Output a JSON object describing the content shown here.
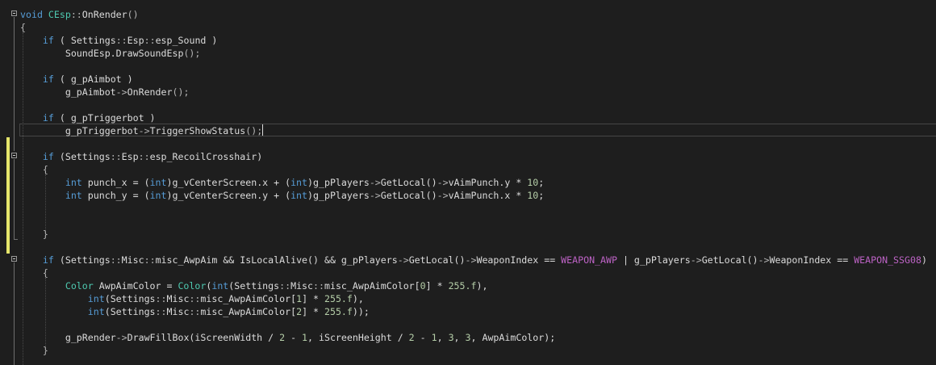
{
  "editor": {
    "caret_line": 9,
    "lines": [
      {
        "indent": "",
        "tokens": [
          {
            "c": "k",
            "t": "void"
          },
          {
            "c": "i",
            "t": " "
          },
          {
            "c": "t",
            "t": "CEsp"
          },
          {
            "c": "p",
            "t": "::"
          },
          {
            "c": "i",
            "t": "OnRender"
          },
          {
            "c": "p",
            "t": "()"
          }
        ]
      },
      {
        "indent": "",
        "tokens": [
          {
            "c": "p",
            "t": "{"
          }
        ]
      },
      {
        "indent": "    ",
        "tokens": [
          {
            "c": "k",
            "t": "if"
          },
          {
            "c": "i",
            "t": " ( "
          },
          {
            "c": "i",
            "t": "Settings"
          },
          {
            "c": "p",
            "t": "::"
          },
          {
            "c": "i",
            "t": "Esp"
          },
          {
            "c": "p",
            "t": "::"
          },
          {
            "c": "i",
            "t": "esp_Sound"
          },
          {
            "c": "i",
            "t": " )"
          }
        ]
      },
      {
        "indent": "        ",
        "tokens": [
          {
            "c": "i",
            "t": "SoundEsp.DrawSoundEsp"
          },
          {
            "c": "p",
            "t": "();"
          }
        ]
      },
      {
        "indent": "",
        "tokens": []
      },
      {
        "indent": "    ",
        "tokens": [
          {
            "c": "k",
            "t": "if"
          },
          {
            "c": "i",
            "t": " ( g_pAimbot )"
          }
        ]
      },
      {
        "indent": "        ",
        "tokens": [
          {
            "c": "i",
            "t": "g_pAimbot"
          },
          {
            "c": "p",
            "t": "->"
          },
          {
            "c": "i",
            "t": "OnRender"
          },
          {
            "c": "p",
            "t": "();"
          }
        ]
      },
      {
        "indent": "",
        "tokens": []
      },
      {
        "indent": "    ",
        "tokens": [
          {
            "c": "k",
            "t": "if"
          },
          {
            "c": "i",
            "t": " ( g_pTriggerbot )"
          }
        ]
      },
      {
        "indent": "        ",
        "tokens": [
          {
            "c": "i",
            "t": "g_pTriggerbot"
          },
          {
            "c": "p",
            "t": "->"
          },
          {
            "c": "i",
            "t": "TriggerShowStatus"
          },
          {
            "c": "p",
            "t": "();"
          }
        ]
      },
      {
        "indent": "",
        "tokens": []
      },
      {
        "indent": "    ",
        "tokens": [
          {
            "c": "k",
            "t": "if"
          },
          {
            "c": "i",
            "t": " (Settings"
          },
          {
            "c": "p",
            "t": "::"
          },
          {
            "c": "i",
            "t": "Esp"
          },
          {
            "c": "p",
            "t": "::"
          },
          {
            "c": "i",
            "t": "esp_RecoilCrosshair)"
          }
        ]
      },
      {
        "indent": "    ",
        "tokens": [
          {
            "c": "p",
            "t": "{"
          }
        ]
      },
      {
        "indent": "        ",
        "tokens": [
          {
            "c": "k",
            "t": "int"
          },
          {
            "c": "i",
            "t": " punch_x = ("
          },
          {
            "c": "k",
            "t": "int"
          },
          {
            "c": "i",
            "t": ")g_vCenterScreen.x + ("
          },
          {
            "c": "k",
            "t": "int"
          },
          {
            "c": "i",
            "t": ")g_pPlayers"
          },
          {
            "c": "p",
            "t": "->"
          },
          {
            "c": "i",
            "t": "GetLocal()"
          },
          {
            "c": "p",
            "t": "->"
          },
          {
            "c": "i",
            "t": "vAimPunch.y * "
          },
          {
            "c": "n",
            "t": "10"
          },
          {
            "c": "i",
            "t": ";"
          }
        ]
      },
      {
        "indent": "        ",
        "tokens": [
          {
            "c": "k",
            "t": "int"
          },
          {
            "c": "i",
            "t": " punch_y = ("
          },
          {
            "c": "k",
            "t": "int"
          },
          {
            "c": "i",
            "t": ")g_vCenterScreen.y + ("
          },
          {
            "c": "k",
            "t": "int"
          },
          {
            "c": "i",
            "t": ")g_pPlayers"
          },
          {
            "c": "p",
            "t": "->"
          },
          {
            "c": "i",
            "t": "GetLocal()"
          },
          {
            "c": "p",
            "t": "->"
          },
          {
            "c": "i",
            "t": "vAimPunch.x * "
          },
          {
            "c": "n",
            "t": "10"
          },
          {
            "c": "i",
            "t": ";"
          }
        ]
      },
      {
        "indent": "",
        "tokens": []
      },
      {
        "indent": "",
        "tokens": []
      },
      {
        "indent": "    ",
        "tokens": [
          {
            "c": "p",
            "t": "}"
          }
        ]
      },
      {
        "indent": "",
        "tokens": []
      },
      {
        "indent": "    ",
        "tokens": [
          {
            "c": "k",
            "t": "if"
          },
          {
            "c": "i",
            "t": " (Settings"
          },
          {
            "c": "p",
            "t": "::"
          },
          {
            "c": "i",
            "t": "Misc"
          },
          {
            "c": "p",
            "t": "::"
          },
          {
            "c": "i",
            "t": "misc_AwpAim && IsLocalAlive() && g_pPlayers"
          },
          {
            "c": "p",
            "t": "->"
          },
          {
            "c": "i",
            "t": "GetLocal()"
          },
          {
            "c": "p",
            "t": "->"
          },
          {
            "c": "i",
            "t": "WeaponIndex == "
          },
          {
            "c": "m",
            "t": "WEAPON_AWP"
          },
          {
            "c": "i",
            "t": " | g_pPlayers"
          },
          {
            "c": "p",
            "t": "->"
          },
          {
            "c": "i",
            "t": "GetLocal()"
          },
          {
            "c": "p",
            "t": "->"
          },
          {
            "c": "i",
            "t": "WeaponIndex == "
          },
          {
            "c": "m",
            "t": "WEAPON_SSG08"
          },
          {
            "c": "i",
            "t": ")"
          }
        ]
      },
      {
        "indent": "    ",
        "tokens": [
          {
            "c": "p",
            "t": "{"
          }
        ]
      },
      {
        "indent": "        ",
        "tokens": [
          {
            "c": "t",
            "t": "Color"
          },
          {
            "c": "i",
            "t": " AwpAimColor = "
          },
          {
            "c": "t",
            "t": "Color"
          },
          {
            "c": "i",
            "t": "("
          },
          {
            "c": "k",
            "t": "int"
          },
          {
            "c": "i",
            "t": "(Settings"
          },
          {
            "c": "p",
            "t": "::"
          },
          {
            "c": "i",
            "t": "Misc"
          },
          {
            "c": "p",
            "t": "::"
          },
          {
            "c": "i",
            "t": "misc_AwpAimColor["
          },
          {
            "c": "n",
            "t": "0"
          },
          {
            "c": "i",
            "t": "] * "
          },
          {
            "c": "n",
            "t": "255.f"
          },
          {
            "c": "i",
            "t": "),"
          }
        ]
      },
      {
        "indent": "            ",
        "tokens": [
          {
            "c": "k",
            "t": "int"
          },
          {
            "c": "i",
            "t": "(Settings"
          },
          {
            "c": "p",
            "t": "::"
          },
          {
            "c": "i",
            "t": "Misc"
          },
          {
            "c": "p",
            "t": "::"
          },
          {
            "c": "i",
            "t": "misc_AwpAimColor["
          },
          {
            "c": "n",
            "t": "1"
          },
          {
            "c": "i",
            "t": "] * "
          },
          {
            "c": "n",
            "t": "255.f"
          },
          {
            "c": "i",
            "t": "),"
          }
        ]
      },
      {
        "indent": "            ",
        "tokens": [
          {
            "c": "k",
            "t": "int"
          },
          {
            "c": "i",
            "t": "(Settings"
          },
          {
            "c": "p",
            "t": "::"
          },
          {
            "c": "i",
            "t": "Misc"
          },
          {
            "c": "p",
            "t": "::"
          },
          {
            "c": "i",
            "t": "misc_AwpAimColor["
          },
          {
            "c": "n",
            "t": "2"
          },
          {
            "c": "i",
            "t": "] * "
          },
          {
            "c": "n",
            "t": "255.f"
          },
          {
            "c": "i",
            "t": "));"
          }
        ]
      },
      {
        "indent": "",
        "tokens": []
      },
      {
        "indent": "        ",
        "tokens": [
          {
            "c": "i",
            "t": "g_pRender"
          },
          {
            "c": "p",
            "t": "->"
          },
          {
            "c": "i",
            "t": "DrawFillBox(iScreenWidth / "
          },
          {
            "c": "n",
            "t": "2"
          },
          {
            "c": "i",
            "t": " - "
          },
          {
            "c": "n",
            "t": "1"
          },
          {
            "c": "i",
            "t": ", iScreenHeight / "
          },
          {
            "c": "n",
            "t": "2"
          },
          {
            "c": "i",
            "t": " - "
          },
          {
            "c": "n",
            "t": "1"
          },
          {
            "c": "i",
            "t": ", "
          },
          {
            "c": "n",
            "t": "3"
          },
          {
            "c": "i",
            "t": ", "
          },
          {
            "c": "n",
            "t": "3"
          },
          {
            "c": "i",
            "t": ", AwpAimColor);"
          }
        ]
      },
      {
        "indent": "    ",
        "tokens": [
          {
            "c": "p",
            "t": "}"
          }
        ]
      }
    ]
  },
  "colors": {
    "background": "#1e1e1e",
    "keyword": "#569cd6",
    "type": "#4ec9b0",
    "macro": "#bd63c5",
    "number": "#b5cea8",
    "identifier": "#dcdcdc",
    "change_marker": "#e5e56b"
  }
}
